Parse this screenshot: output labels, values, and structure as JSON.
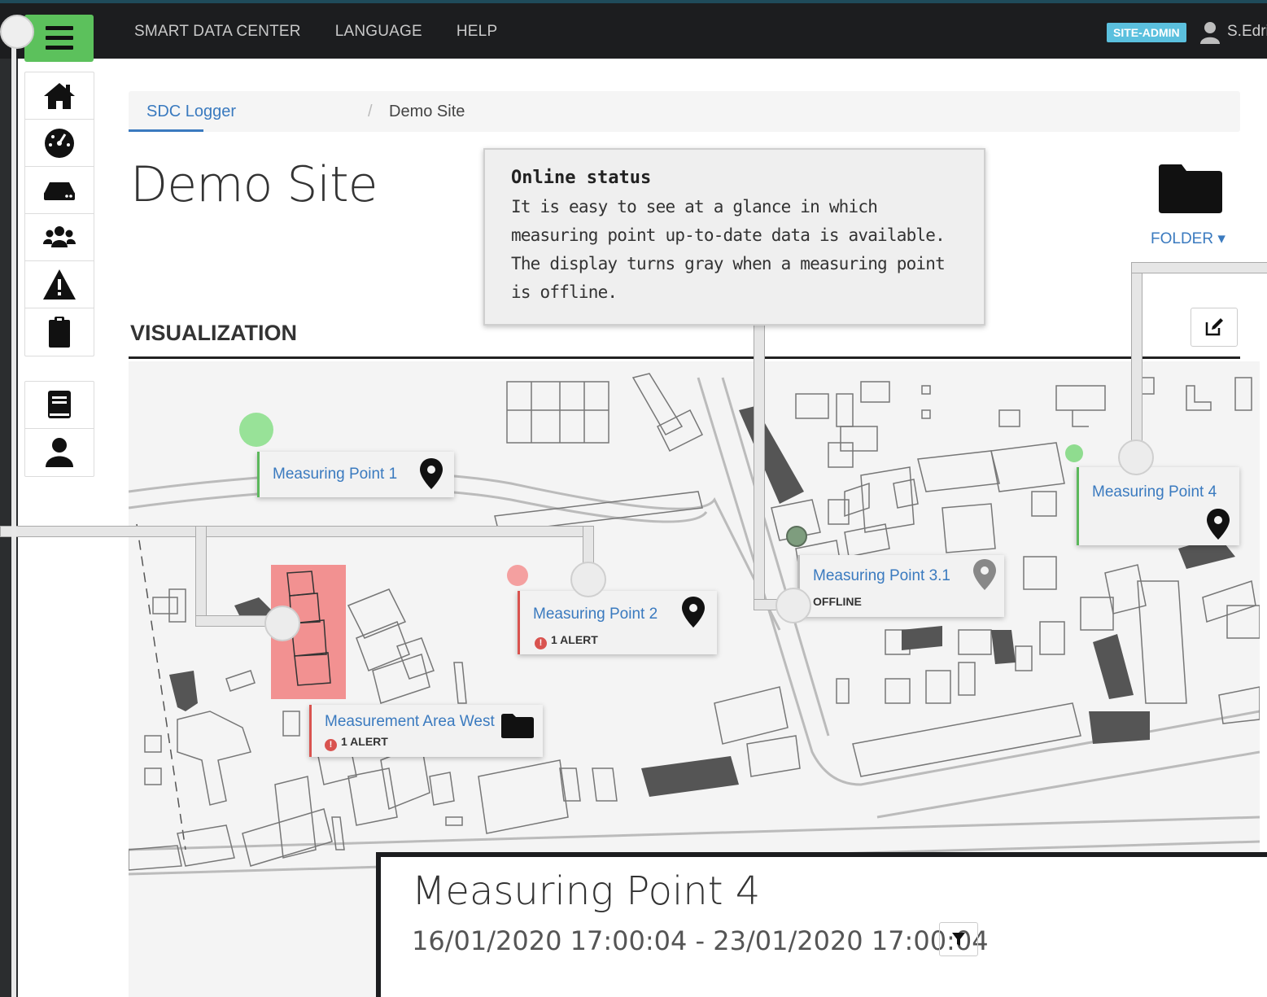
{
  "navbar": {
    "links": [
      "SMART DATA CENTER",
      "LANGUAGE",
      "HELP"
    ],
    "role_badge": "SITE-ADMIN",
    "user_name": "S.Edri",
    "accent": "#5cc15c"
  },
  "sidebar": {
    "icons_top": [
      "home-icon",
      "dashboard-icon",
      "device-icon",
      "users-icon",
      "warning-icon",
      "clipboard-icon"
    ],
    "icons_bottom": [
      "manual-icon",
      "profile-icon"
    ]
  },
  "breadcrumb": {
    "link": "SDC Logger",
    "separator": "/",
    "current": "Demo Site"
  },
  "page": {
    "title": "Demo Site",
    "folder_label": "FOLDER ▾",
    "section_title": "VISUALIZATION"
  },
  "callout": {
    "title": "Online status",
    "text": "It is easy to see at a glance in which measuring point up-to-date data is available. The display turns gray when a measuring point is offline."
  },
  "markers": [
    {
      "name": "Measuring Point 1",
      "status": "",
      "state": "online"
    },
    {
      "name": "Measuring Point 2",
      "status": "1 ALERT",
      "state": "alert"
    },
    {
      "name": "Measurement Area West",
      "status": "1 ALERT",
      "state": "alert"
    },
    {
      "name": "Measuring Point 3.1",
      "status": "OFFLINE",
      "state": "offline"
    },
    {
      "name": "Measuring Point 4",
      "status": "",
      "state": "online"
    }
  ],
  "detail": {
    "title": "Measuring Point 4",
    "range": "16/01/2020 17:00:04 - 23/01/2020 17:00:04"
  },
  "colors": {
    "online": "#8fdc8f",
    "alert": "#f08080",
    "offline": "#7c9a7c",
    "link": "#3a7abf",
    "badge": "#5bc0de"
  }
}
